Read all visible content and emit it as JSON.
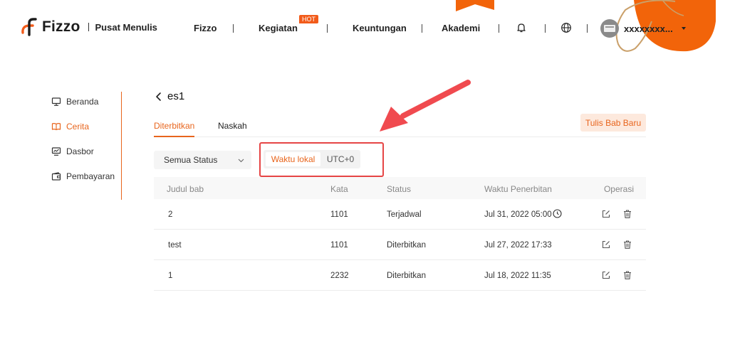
{
  "brand": {
    "name": "Fizzo",
    "subtitle": "Pusat Menulis"
  },
  "nav": {
    "items": [
      "Fizzo",
      "Kegiatan",
      "Keuntungan",
      "Akademi"
    ],
    "hot_badge": "HOT"
  },
  "user": {
    "name": "xxxxxxxx..."
  },
  "sidebar": {
    "items": [
      {
        "label": "Beranda",
        "icon": "monitor-icon"
      },
      {
        "label": "Cerita",
        "icon": "book-icon",
        "active": true
      },
      {
        "label": "Dasbor",
        "icon": "chart-icon"
      },
      {
        "label": "Pembayaran",
        "icon": "wallet-icon"
      }
    ]
  },
  "page": {
    "title": "es1"
  },
  "tabs": [
    {
      "label": "Diterbitkan",
      "active": true
    },
    {
      "label": "Naskah"
    }
  ],
  "actions": {
    "new_chapter": "Tulis Bab Baru"
  },
  "filters": {
    "status_value": "Semua Status",
    "timezone": {
      "local": "Waktu lokal",
      "utc": "UTC+0",
      "selected": "local"
    }
  },
  "table": {
    "headers": [
      "Judul bab",
      "Kata",
      "Status",
      "Waktu Penerbitan",
      "Operasi"
    ],
    "rows": [
      {
        "title": "2",
        "words": "1101",
        "status": "Terjadwal",
        "time": "Jul 31, 2022 05:00",
        "scheduled": true
      },
      {
        "title": "test",
        "words": "1101",
        "status": "Diterbitkan",
        "time": "Jul 27, 2022 17:33"
      },
      {
        "title": "1",
        "words": "2232",
        "status": "Diterbitkan",
        "time": "Jul 18, 2022 11:35"
      }
    ]
  },
  "colors": {
    "accent": "#e8651d",
    "highlight": "#e64545",
    "accent_light": "#fde9dd"
  }
}
